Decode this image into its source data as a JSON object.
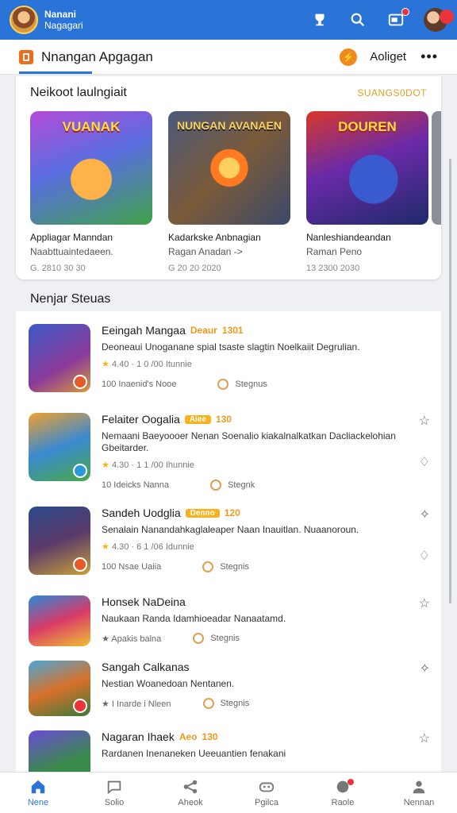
{
  "header": {
    "brand_line1": "Nanani",
    "brand_line2": "Nagagari"
  },
  "tabbar": {
    "title": "Nnangan Apgagan",
    "right_label": "Aoliget"
  },
  "featured": {
    "title": "Neikoot laulngiait",
    "link": "SUANGS0DOT",
    "items": [
      {
        "art": "VUANAK",
        "name": "Appliagar Manndan",
        "sub": "Naabttuaintedaeen.",
        "meta": "G. 2810 30 30"
      },
      {
        "art": "NUNGAN AVANAEN",
        "name": "Kadarkske Anbnagian",
        "sub": "Ragan Anadan ->",
        "meta": "G 20 20 2020"
      },
      {
        "art": "DOUREN",
        "name": "Nanleshiandeandan",
        "sub": "Raman Peno",
        "meta": "13 2300 2030"
      }
    ]
  },
  "section": {
    "title": "Nenjar Steuas"
  },
  "list": [
    {
      "name": "Eeingah Mangaa",
      "tag": "Deaur",
      "tag_style": "text",
      "num": "1301",
      "desc": "Deoneaui Unoganane spial tsaste slagtin Noelkaiit Degrulian.",
      "stats": "4.40 · 1 0 /00 Itunnie",
      "foot": "100 Inaenid's Nooe",
      "chip": "Stegnus",
      "action_top": "",
      "action_bottom": ""
    },
    {
      "name": "Felaiter Oogalia",
      "tag": "Aiee",
      "tag_style": "box",
      "num": "130",
      "desc": "Nemaani Baeyoooer Nenan Soenalio kiakalnalkatkan Dacliackelohian Gbeitarder.",
      "stats": "4.30 · 1 1 /00 Ihunnie",
      "foot": "10 Ideicks Nanna",
      "chip": "Stegnk",
      "action_top": "☆",
      "action_bottom": "♢"
    },
    {
      "name": "Sandeh Uodglia",
      "tag": "Denno",
      "tag_style": "box",
      "num": "120",
      "desc": "Senalain Nanandahkaglaleaper Naan Inauitlan. Nuaanoroun.",
      "stats": "4.30 · 6 1 /06 Idunnie",
      "foot": "100 Nsae Uaiia",
      "chip": "Stegnis",
      "action_top": "✧",
      "action_bottom": "♢"
    },
    {
      "name": "Honsek NaDeina",
      "tag": "",
      "tag_style": "text",
      "num": "",
      "desc": "Naukaan Randa Idamhioeadar Nanaatamd.",
      "stats": "",
      "foot": "★ Apakis balna",
      "chip": "Stegnis",
      "action_top": "☆",
      "action_bottom": ""
    },
    {
      "name": "Sangah Calkanas",
      "tag": "",
      "tag_style": "text",
      "num": "",
      "desc": "Nestian Woanedoan Nentanen.",
      "stats": "",
      "foot": "★ I Inarde i Nleen",
      "chip": "Stegnis",
      "action_top": "✧",
      "action_bottom": ""
    },
    {
      "name": "Nagaran Ihaek",
      "tag": "Aeo",
      "tag_style": "text",
      "num": "130",
      "desc": "Rardanen Inenaneken Ueeuantien fenakani",
      "stats": "",
      "foot": "",
      "chip": "",
      "action_top": "☆",
      "action_bottom": ""
    }
  ],
  "bottomnav": [
    {
      "label": "Nene",
      "icon": "home-icon"
    },
    {
      "label": "Solio",
      "icon": "chat-bubble-icon"
    },
    {
      "label": "Aheok",
      "icon": "share-icon"
    },
    {
      "label": "Pgilca",
      "icon": "gamepad-icon"
    },
    {
      "label": "Raole",
      "icon": "notification-icon"
    },
    {
      "label": "Nennan",
      "icon": "profile-icon"
    }
  ],
  "colors": {
    "brand_blue": "#2a74d8",
    "accent_orange": "#f06a1c",
    "star_yellow": "#f5b70f",
    "badge_red": "#e8343a"
  }
}
